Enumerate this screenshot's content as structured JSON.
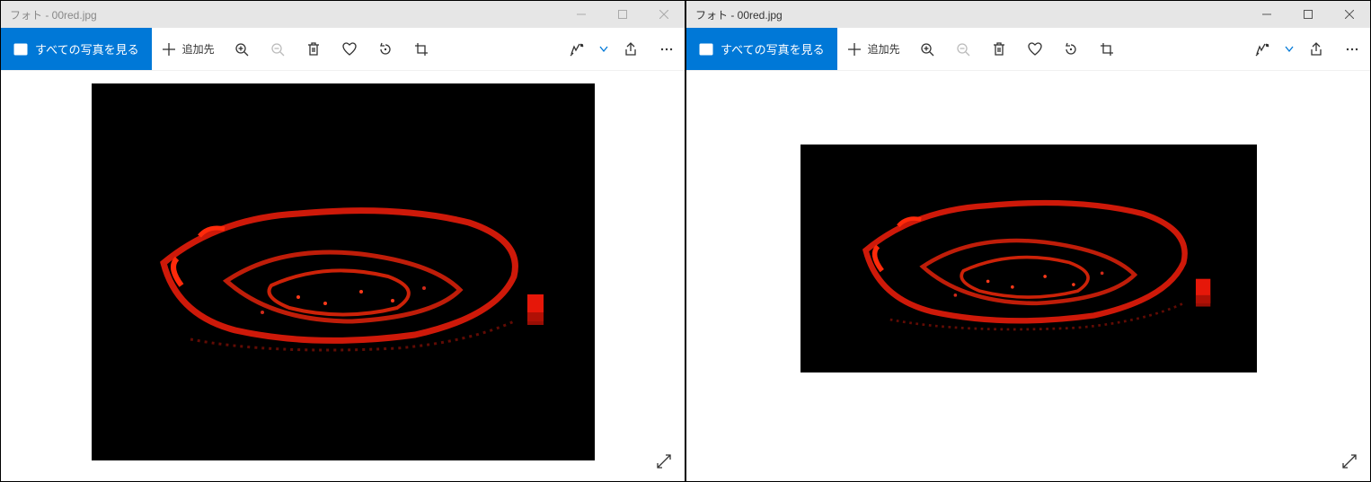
{
  "windows": [
    {
      "title": "フォト - 00red.jpg",
      "focused": false
    },
    {
      "title": "フォト - 00red.jpg",
      "focused": true
    }
  ],
  "toolbar": {
    "see_all_label": "すべての写真を見る",
    "add_to_label": "追加先"
  },
  "icons": {
    "picture": "picture-icon",
    "plus": "plus-icon",
    "zoom_in": "zoom-in-icon",
    "zoom_out": "zoom-out-icon",
    "delete": "trash-icon",
    "favorite": "heart-icon",
    "rotate": "rotate-icon",
    "crop": "crop-icon",
    "edit": "edit-tools-icon",
    "chevron": "chevron-down-icon",
    "share": "share-icon",
    "more": "more-icon",
    "minimize": "minimize-icon",
    "maximize": "maximize-icon",
    "close": "close-icon",
    "expand": "expand-icon"
  }
}
